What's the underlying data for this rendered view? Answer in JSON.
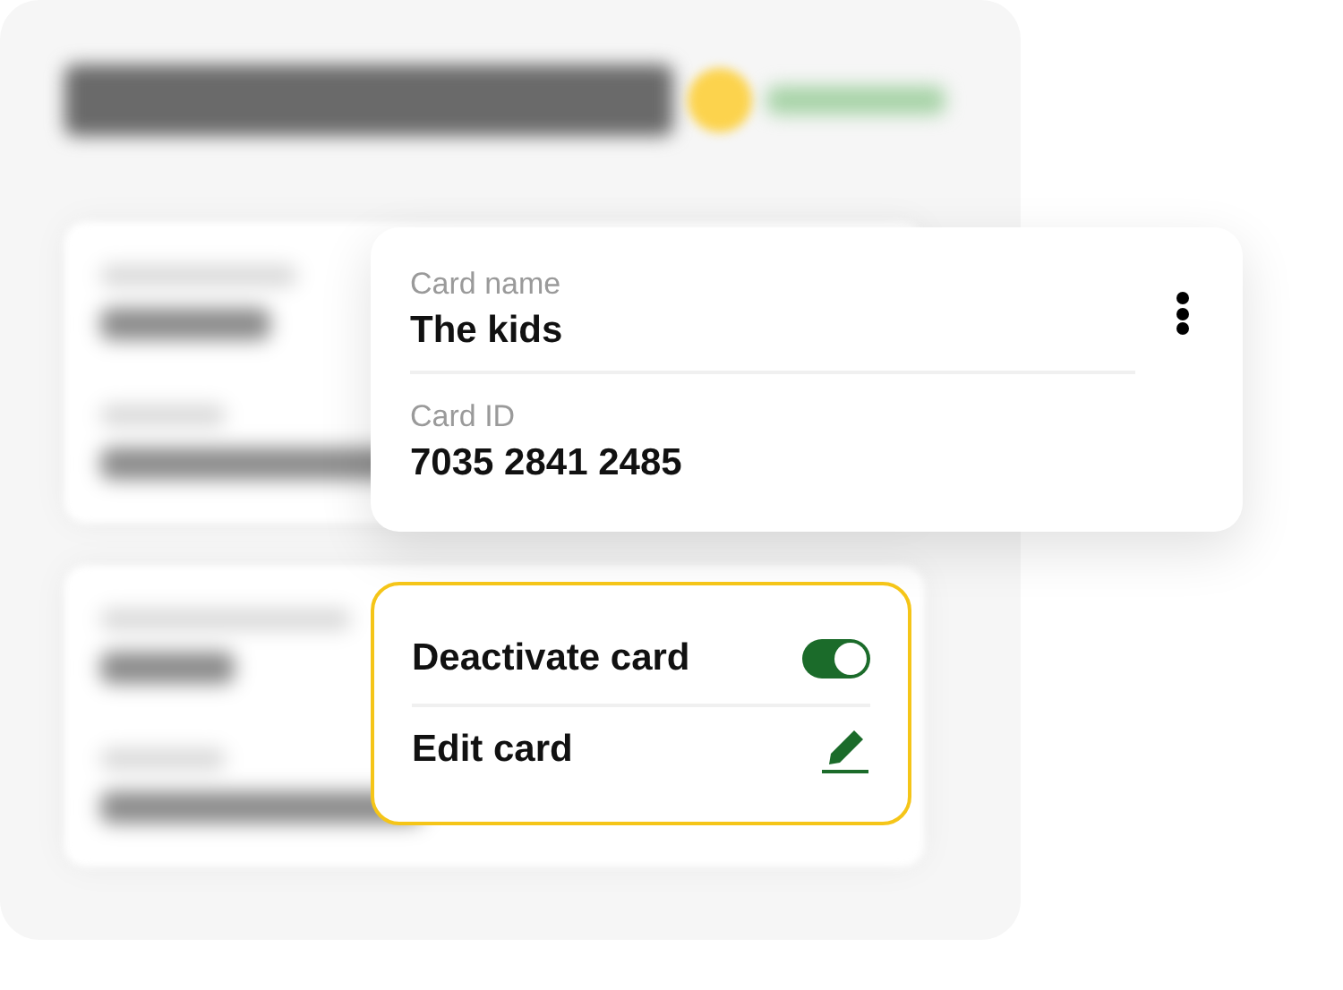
{
  "card": {
    "fields": [
      {
        "label": "Card name",
        "value": "The kids"
      },
      {
        "label": "Card ID",
        "value": "7035 2841 2485"
      }
    ]
  },
  "menu": {
    "items": [
      {
        "kind": "toggle",
        "label": "Deactivate card",
        "on": true
      },
      {
        "kind": "action",
        "label": "Edit card"
      }
    ]
  }
}
